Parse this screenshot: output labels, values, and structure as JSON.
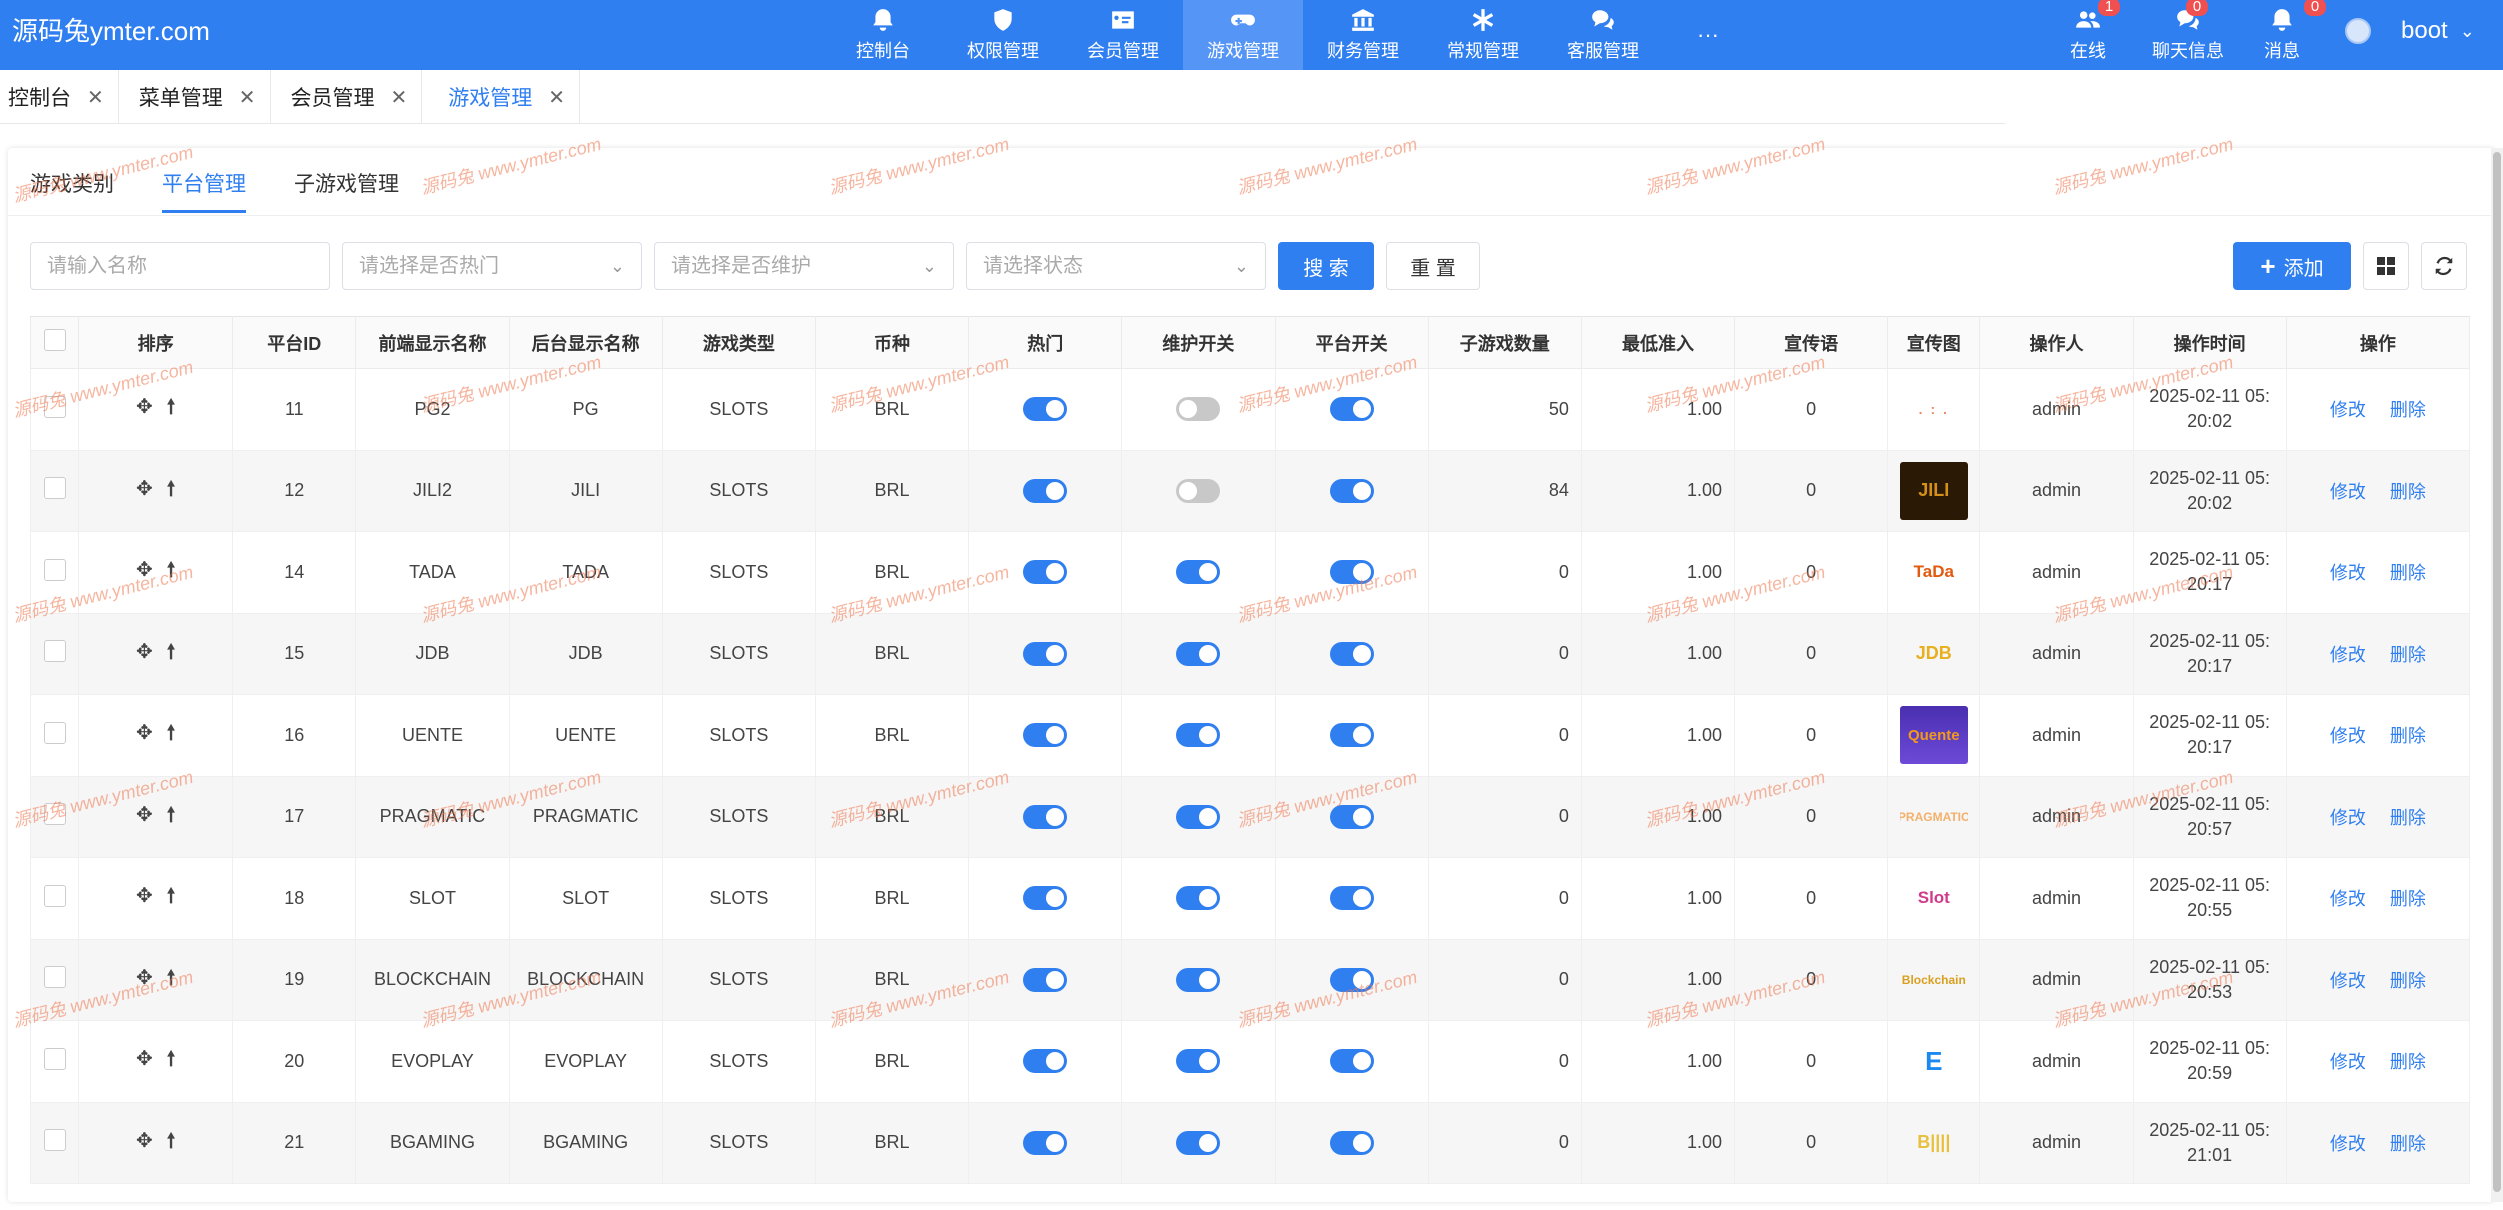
{
  "brand": "源码兔ymter.com",
  "nav": [
    {
      "label": "控制台",
      "icon": "bell-icon"
    },
    {
      "label": "权限管理",
      "icon": "shield-icon"
    },
    {
      "label": "会员管理",
      "icon": "id-card-icon"
    },
    {
      "label": "游戏管理",
      "icon": "gamepad-icon"
    },
    {
      "label": "财务管理",
      "icon": "bank-icon"
    },
    {
      "label": "常规管理",
      "icon": "asterisk-icon"
    },
    {
      "label": "客服管理",
      "icon": "chat-icon"
    }
  ],
  "nav_more": "···",
  "tools": {
    "online": {
      "label": "在线",
      "badge": "1"
    },
    "chat": {
      "label": "聊天信息",
      "badge": "0"
    },
    "msg": {
      "label": "消息",
      "badge": "0"
    }
  },
  "user": "boot",
  "tabs": [
    "控制台",
    "菜单管理",
    "会员管理",
    "游戏管理"
  ],
  "subtabs": [
    "游戏类别",
    "平台管理",
    "子游戏管理"
  ],
  "filters": {
    "name": "请输入名称",
    "hot": "请选择是否热门",
    "maint": "请选择是否维护",
    "status": "请选择状态"
  },
  "buttons": {
    "search": "搜 索",
    "reset": "重 置",
    "add": "添加"
  },
  "columns": [
    "排序",
    "平台ID",
    "前端显示名称",
    "后台显示名称",
    "游戏类型",
    "币种",
    "热门",
    "维护开关",
    "平台开关",
    "子游戏数量",
    "最低准入",
    "宣传语",
    "宣传图",
    "操作人",
    "操作时间",
    "操作"
  ],
  "actions": {
    "edit": "修改",
    "del": "删除"
  },
  "watermark": "源码兔 www.ymter.com",
  "rows": [
    {
      "id": "11",
      "front": "PG2",
      "back": "PG",
      "type": "SLOTS",
      "cur": "BRL",
      "hot": true,
      "maint": false,
      "plat": true,
      "sub": "50",
      "min": "1.00",
      "slogan": "0",
      "op": "admin",
      "t1": "2025-02-11 05:",
      "t2": "20:02",
      "img": "dots"
    },
    {
      "id": "12",
      "front": "JILI2",
      "back": "JILI",
      "type": "SLOTS",
      "cur": "BRL",
      "hot": true,
      "maint": false,
      "plat": true,
      "sub": "84",
      "min": "1.00",
      "slogan": "0",
      "op": "admin",
      "t1": "2025-02-11 05:",
      "t2": "20:02",
      "img": "JILI"
    },
    {
      "id": "14",
      "front": "TADA",
      "back": "TADA",
      "type": "SLOTS",
      "cur": "BRL",
      "hot": true,
      "maint": true,
      "plat": true,
      "sub": "0",
      "min": "1.00",
      "slogan": "0",
      "op": "admin",
      "t1": "2025-02-11 05:",
      "t2": "20:17",
      "img": "TaDa"
    },
    {
      "id": "15",
      "front": "JDB",
      "back": "JDB",
      "type": "SLOTS",
      "cur": "BRL",
      "hot": true,
      "maint": true,
      "plat": true,
      "sub": "0",
      "min": "1.00",
      "slogan": "0",
      "op": "admin",
      "t1": "2025-02-11 05:",
      "t2": "20:17",
      "img": "JDB"
    },
    {
      "id": "16",
      "front": "UENTE",
      "back": "UENTE",
      "type": "SLOTS",
      "cur": "BRL",
      "hot": true,
      "maint": true,
      "plat": true,
      "sub": "0",
      "min": "1.00",
      "slogan": "0",
      "op": "admin",
      "t1": "2025-02-11 05:",
      "t2": "20:17",
      "img": "Quente"
    },
    {
      "id": "17",
      "front": "PRAGMATIC",
      "back": "PRAGMATIC",
      "type": "SLOTS",
      "cur": "BRL",
      "hot": true,
      "maint": true,
      "plat": true,
      "sub": "0",
      "min": "1.00",
      "slogan": "0",
      "op": "admin",
      "t1": "2025-02-11 05:",
      "t2": "20:57",
      "img": "PRAG"
    },
    {
      "id": "18",
      "front": "SLOT",
      "back": "SLOT",
      "type": "SLOTS",
      "cur": "BRL",
      "hot": true,
      "maint": true,
      "plat": true,
      "sub": "0",
      "min": "1.00",
      "slogan": "0",
      "op": "admin",
      "t1": "2025-02-11 05:",
      "t2": "20:55",
      "img": "Slot"
    },
    {
      "id": "19",
      "front": "BLOCKCHAIN",
      "back": "BLOCKCHAIN",
      "type": "SLOTS",
      "cur": "BRL",
      "hot": true,
      "maint": true,
      "plat": true,
      "sub": "0",
      "min": "1.00",
      "slogan": "0",
      "op": "admin",
      "t1": "2025-02-11 05:",
      "t2": "20:53",
      "img": "Blockchain"
    },
    {
      "id": "20",
      "front": "EVOPLAY",
      "back": "EVOPLAY",
      "type": "SLOTS",
      "cur": "BRL",
      "hot": true,
      "maint": true,
      "plat": true,
      "sub": "0",
      "min": "1.00",
      "slogan": "0",
      "op": "admin",
      "t1": "2025-02-11 05:",
      "t2": "20:59",
      "img": "E"
    },
    {
      "id": "21",
      "front": "BGAMING",
      "back": "BGAMING",
      "type": "SLOTS",
      "cur": "BRL",
      "hot": true,
      "maint": true,
      "plat": true,
      "sub": "0",
      "min": "1.00",
      "slogan": "0",
      "op": "admin",
      "t1": "2025-02-11 05:",
      "t2": "21:01",
      "img": "B"
    }
  ]
}
